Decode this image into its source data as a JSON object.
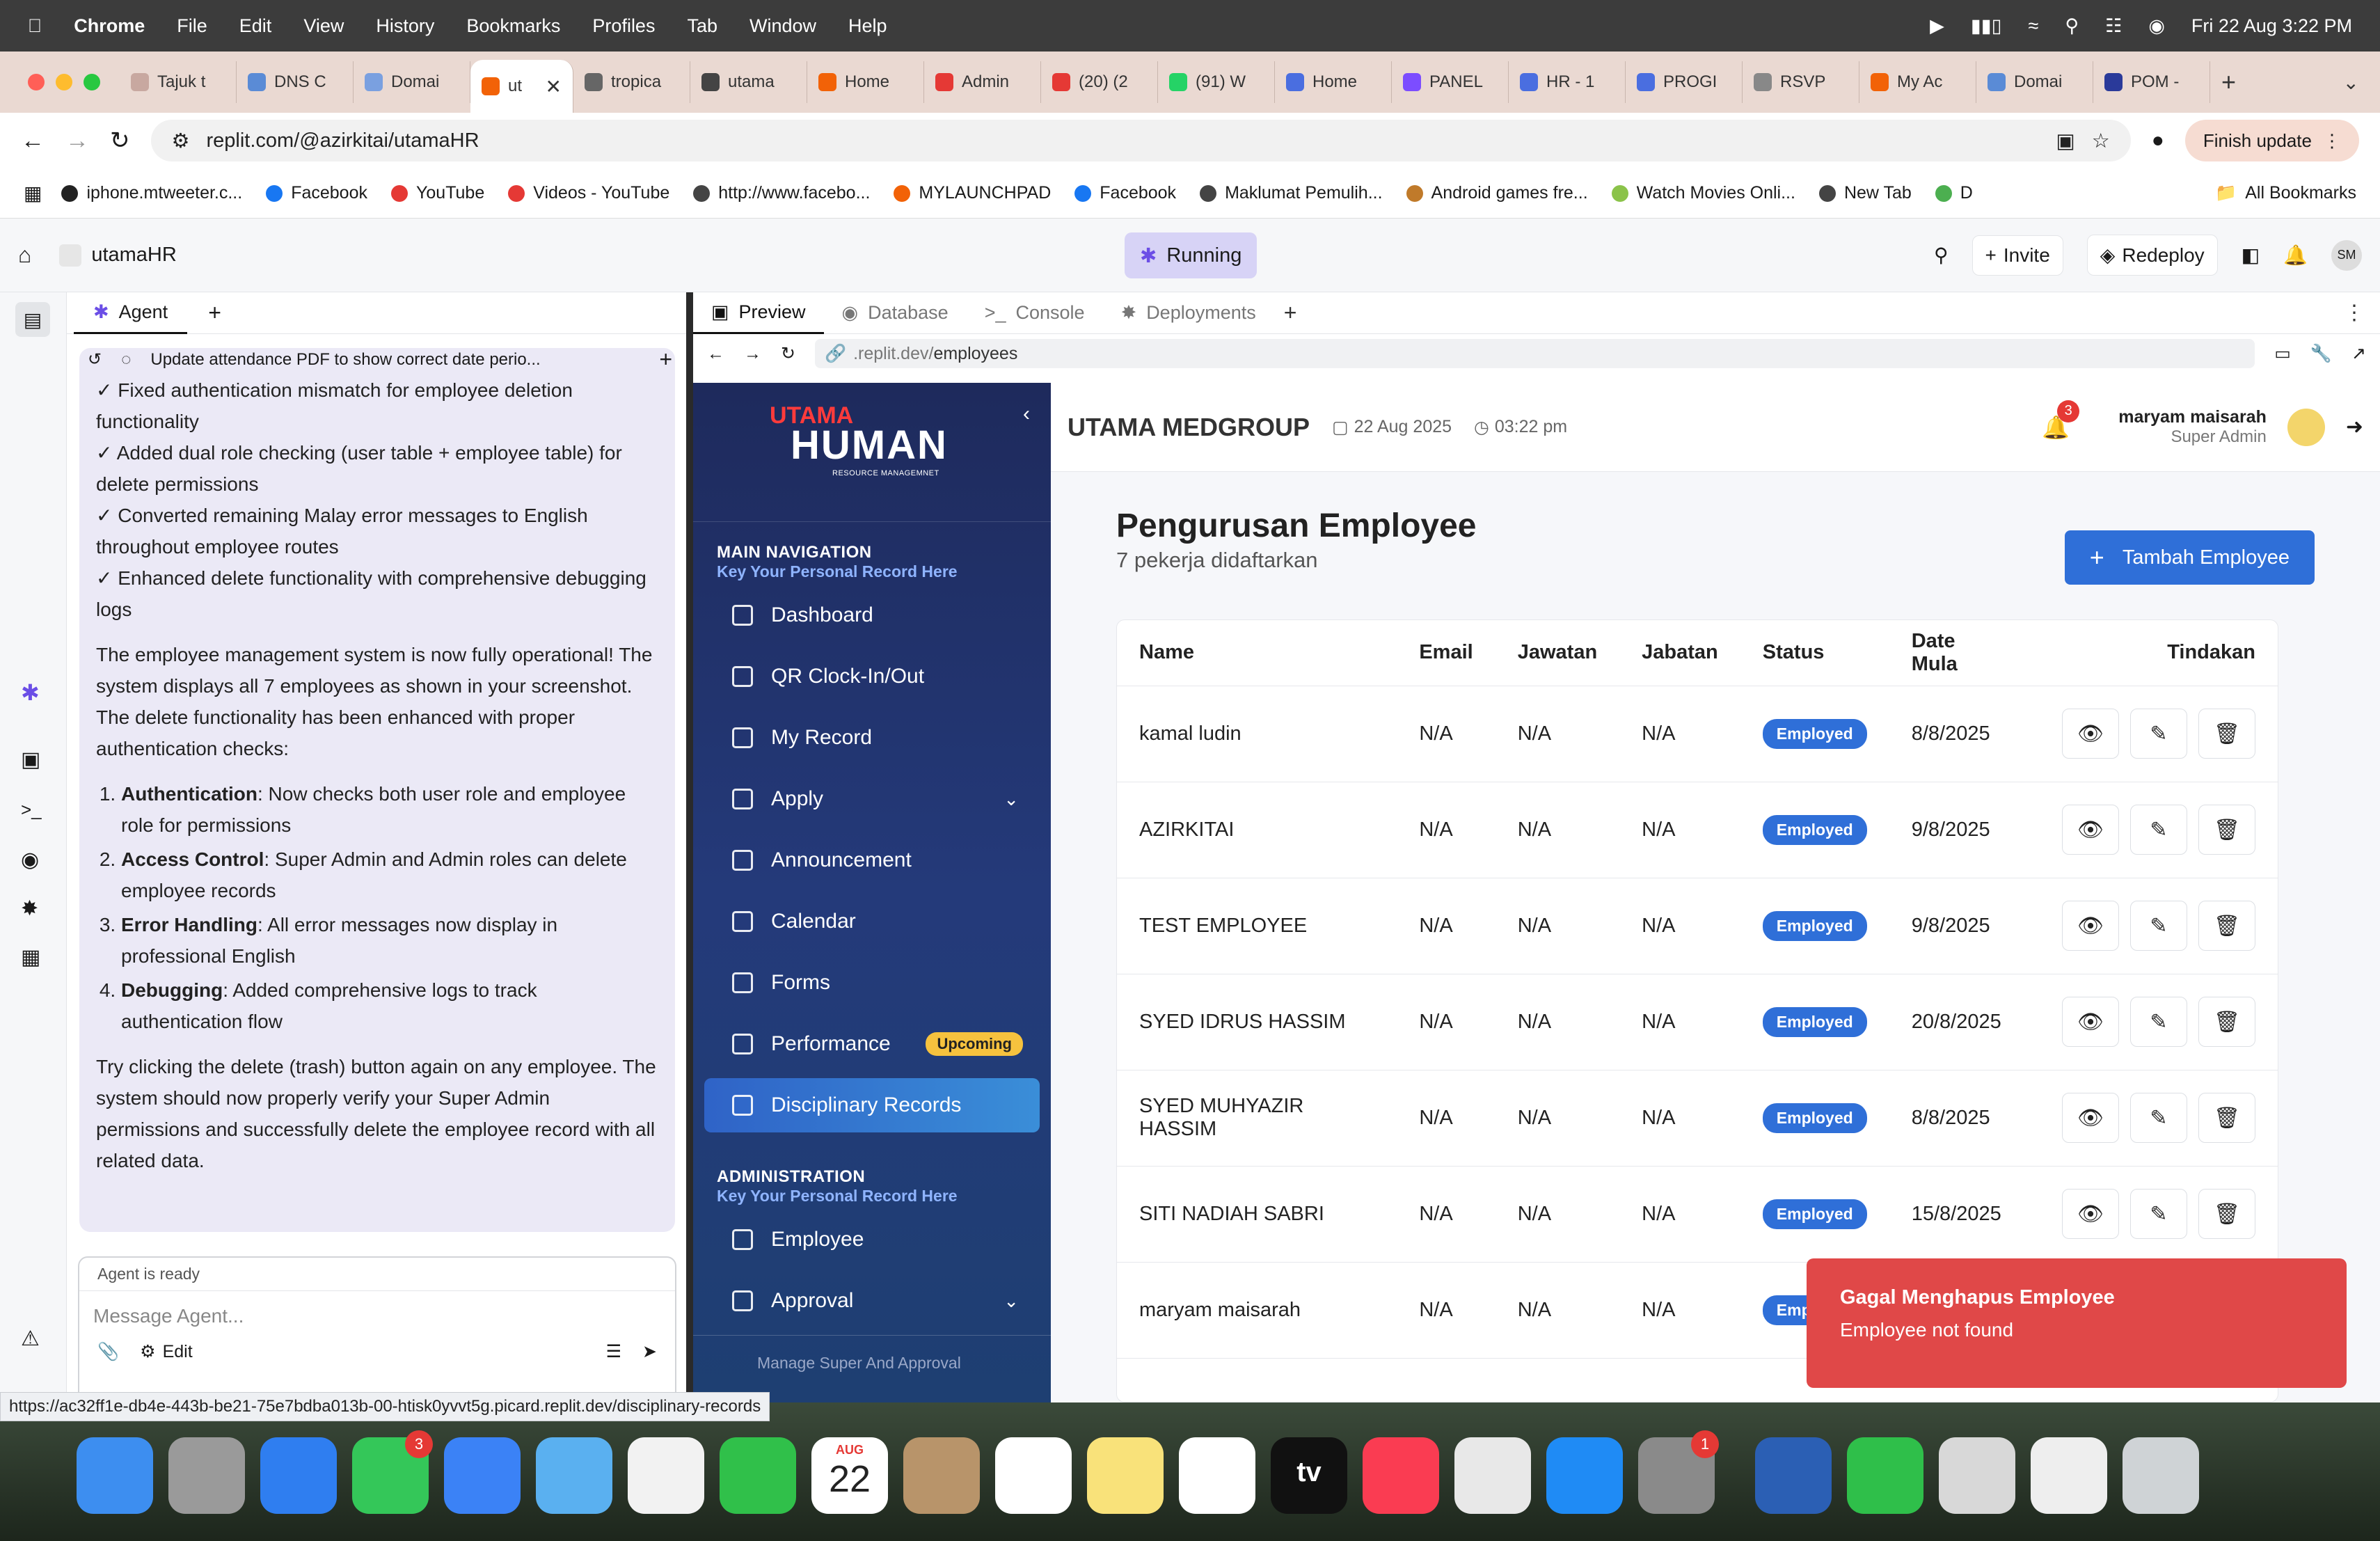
{
  "menubar": {
    "app": "Chrome",
    "items": [
      "File",
      "Edit",
      "View",
      "History",
      "Bookmarks",
      "Profiles",
      "Tab",
      "Window",
      "Help"
    ],
    "datetime": "Fri 22 Aug  3:22 PM"
  },
  "chrome_tabs": [
    {
      "label": "Tajuk t",
      "color": "#c8a8a0"
    },
    {
      "label": "DNS C",
      "color": "#5a8bd6"
    },
    {
      "label": "Domai",
      "color": "#7aa0e0"
    },
    {
      "label": "ut",
      "color": "#f26207",
      "active": true
    },
    {
      "label": "tropica",
      "color": "#666"
    },
    {
      "label": "utama",
      "color": "#444"
    },
    {
      "label": "Home",
      "color": "#f26207"
    },
    {
      "label": "Admin",
      "color": "#e53935"
    },
    {
      "label": "(20) (2",
      "color": "#e53935"
    },
    {
      "label": "(91) W",
      "color": "#25d366"
    },
    {
      "label": "Home",
      "color": "#4a6ee0"
    },
    {
      "label": "PANEL",
      "color": "#7c4dff"
    },
    {
      "label": "HR - 1",
      "color": "#4a6ee0"
    },
    {
      "label": "PROGI",
      "color": "#4a6ee0"
    },
    {
      "label": "RSVP",
      "color": "#888"
    },
    {
      "label": "My Ac",
      "color": "#f26207"
    },
    {
      "label": "Domai",
      "color": "#5a8bd6"
    },
    {
      "label": "POM -",
      "color": "#2a3a9a"
    }
  ],
  "address": {
    "url": "replit.com/@azirkitai/utamaHR",
    "finish_update": "Finish update"
  },
  "bookmarks": [
    "iphone.mtweeter.c...",
    "Facebook",
    "YouTube",
    "Videos - YouTube",
    "http://www.facebo...",
    "MYLAUNCHPAD",
    "Facebook",
    "Maklumat Pemulih...",
    "Android games fre...",
    "Watch Movies Onli...",
    "New Tab",
    "D"
  ],
  "all_bookmarks": "All Bookmarks",
  "replit": {
    "project": "utamaHR",
    "status": "Running",
    "invite": "Invite",
    "redeploy": "Redeploy",
    "avatar": "SM"
  },
  "agent": {
    "tab": "Agent",
    "thread_title": "Update attendance PDF to show correct date perio...",
    "checks": [
      "✓ Fixed authentication mismatch for employee deletion functionality",
      "✓ Added dual role checking (user table + employee table) for delete permissions",
      "✓ Converted remaining Malay error messages to English throughout employee routes",
      "✓ Enhanced delete functionality with comprehensive debugging logs"
    ],
    "para1": "The employee management system is now fully operational! The system displays all 7 employees as shown in your screenshot. The delete functionality has been enhanced with proper authentication checks:",
    "list": [
      {
        "bold": "Authentication",
        "text": ": Now checks both user role and employee role for permissions"
      },
      {
        "bold": "Access Control",
        "text": ": Super Admin and Admin roles can delete employee records"
      },
      {
        "bold": "Error Handling",
        "text": ": All error messages now display in professional English"
      },
      {
        "bold": "Debugging",
        "text": ": Added comprehensive logs to track authentication flow"
      }
    ],
    "para2": "Try clicking the delete (trash) button again on any employee. The system should now properly verify your Super Admin permissions and successfully delete the employee record with all related data.",
    "ready": "Agent is ready",
    "placeholder": "Message Agent...",
    "edit": "Edit"
  },
  "preview": {
    "tabs": [
      "Preview",
      "Database",
      "Console",
      "Deployments"
    ],
    "url_prefix": ".replit.dev/",
    "url_path": "employees"
  },
  "app": {
    "logo_top": "UTAMA",
    "logo_main": "HUMAN",
    "logo_sub": "RESOURCE MANAGEMNET",
    "company": "UTAMA MEDGROUP",
    "date": "22 Aug 2025",
    "time": "03:22 pm",
    "notif_count": "3",
    "user_name": "maryam maisarah",
    "user_role": "Super Admin",
    "nav_head": "MAIN NAVIGATION",
    "nav_sub": "Key Your Personal Record Here",
    "nav": [
      "Dashboard",
      "QR Clock-In/Out",
      "My Record",
      "Apply",
      "Announcement",
      "Calendar",
      "Forms",
      "Performance",
      "Disciplinary Records"
    ],
    "upcoming": "Upcoming",
    "admin_head": "ADMINISTRATION",
    "admin_sub": "Key Your Personal Record Here",
    "admin_nav": [
      "Employee",
      "Approval"
    ],
    "admin_footer": "Manage Super And Approval",
    "page_title": "Pengurusan Employee",
    "page_sub": "7 pekerja didaftarkan",
    "add_button": "Tambah Employee",
    "columns": [
      "Name",
      "Email",
      "Jawatan",
      "Jabatan",
      "Status",
      "Date Mula",
      "Tindakan"
    ],
    "rows": [
      {
        "name": "kamal ludin",
        "email": "N/A",
        "jawatan": "N/A",
        "jabatan": "N/A",
        "status": "Employed",
        "date": "8/8/2025"
      },
      {
        "name": "AZIRKITAI",
        "email": "N/A",
        "jawatan": "N/A",
        "jabatan": "N/A",
        "status": "Employed",
        "date": "9/8/2025"
      },
      {
        "name": "TEST EMPLOYEE",
        "email": "N/A",
        "jawatan": "N/A",
        "jabatan": "N/A",
        "status": "Employed",
        "date": "9/8/2025"
      },
      {
        "name": "SYED IDRUS HASSIM",
        "email": "N/A",
        "jawatan": "N/A",
        "jabatan": "N/A",
        "status": "Employed",
        "date": "20/8/2025"
      },
      {
        "name": "SYED MUHYAZIR HASSIM",
        "email": "N/A",
        "jawatan": "N/A",
        "jabatan": "N/A",
        "status": "Employed",
        "date": "8/8/2025"
      },
      {
        "name": "SITI NADIAH SABRI",
        "email": "N/A",
        "jawatan": "N/A",
        "jabatan": "N/A",
        "status": "Employed",
        "date": "15/8/2025"
      },
      {
        "name": "maryam maisarah",
        "email": "N/A",
        "jawatan": "N/A",
        "jabatan": "N/A",
        "status": "Employed",
        "date": ""
      }
    ],
    "toast_title": "Gagal Menghapus Employee",
    "toast_msg": "Employee not found"
  },
  "status_link": "https://ac32ff1e-db4e-443b-be21-75e7bdba013b-00-htisk0yvvt5g.picard.replit.dev/disciplinary-records",
  "dock": [
    {
      "name": "finder",
      "color": "#3d8ef0"
    },
    {
      "name": "launchpad",
      "color": "#9a9a9a"
    },
    {
      "name": "safari",
      "color": "#2f7ef0"
    },
    {
      "name": "messages",
      "color": "#34c759",
      "badge": "3"
    },
    {
      "name": "mail",
      "color": "#3b82f6"
    },
    {
      "name": "maps",
      "color": "#5ab0f0"
    },
    {
      "name": "photos",
      "color": "#f2f2f2"
    },
    {
      "name": "facetime",
      "color": "#30c04a"
    },
    {
      "name": "calendar",
      "color": "#ffffff",
      "month": "AUG",
      "day": "22"
    },
    {
      "name": "contacts",
      "color": "#b8946a"
    },
    {
      "name": "reminders",
      "color": "#ffffff"
    },
    {
      "name": "notes",
      "color": "#f9e27a"
    },
    {
      "name": "freeform",
      "color": "#ffffff"
    },
    {
      "name": "tv",
      "color": "#111111",
      "label": "tv"
    },
    {
      "name": "music",
      "color": "#fa3c52"
    },
    {
      "name": "chrome",
      "color": "#e8e8e8"
    },
    {
      "name": "app-store",
      "color": "#1f8bf5"
    },
    {
      "name": "system-settings",
      "color": "#8a8a8a",
      "badge": "1"
    },
    {
      "name": "word",
      "color": "#2b5fb4"
    },
    {
      "name": "numbers",
      "color": "#2fbf4a"
    },
    {
      "name": "script-editor",
      "color": "#d8d8d8"
    },
    {
      "name": "document",
      "color": "#eeeeee"
    },
    {
      "name": "trash",
      "color": "#cfd3d6"
    }
  ]
}
